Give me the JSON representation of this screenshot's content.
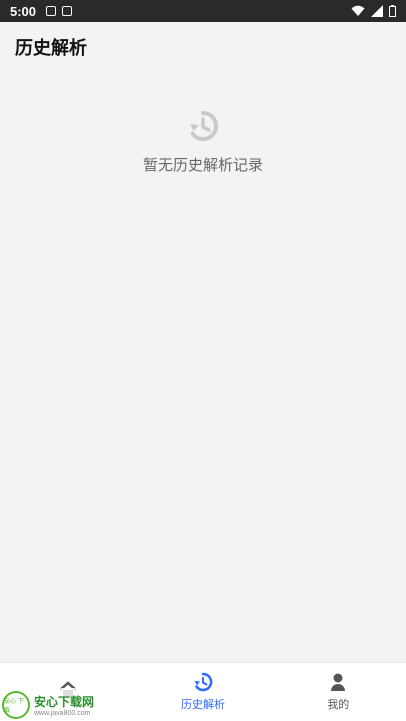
{
  "statusbar": {
    "time": "5:00"
  },
  "header": {
    "title": "历史解析"
  },
  "empty_state": {
    "icon": "history-icon",
    "text": "暂无历史解析记录"
  },
  "tabbar": {
    "tabs": [
      {
        "label": "",
        "icon": "home-icon",
        "active": false
      },
      {
        "label": "历史解析",
        "icon": "history-icon",
        "active": true
      },
      {
        "label": "我的",
        "icon": "user-icon",
        "active": false
      }
    ]
  },
  "watermark": {
    "title": "安心下载网",
    "subtitle": "www.java800.com",
    "badge": "安心\n下载"
  },
  "colors": {
    "accent": "#2f6bff",
    "status_bar": "#2a2a2a",
    "background": "#f2f3f5"
  }
}
